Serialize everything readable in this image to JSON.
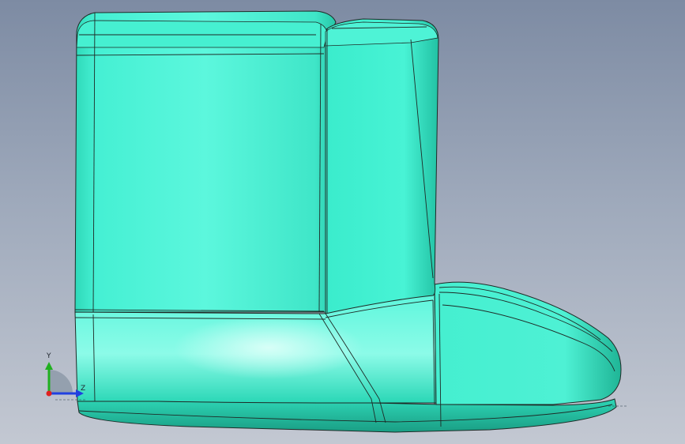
{
  "viewport": {
    "background_top": "#7d8ba3",
    "background_bottom": "#c3c8d2"
  },
  "model": {
    "name": "boot",
    "surface_color": "#3ff2d0",
    "edge_color": "#1e2a26"
  },
  "triad": {
    "y_label": "Y",
    "z_label": "Z",
    "x_color": "#e02020",
    "y_color": "#20b020",
    "z_color": "#2040e0"
  }
}
